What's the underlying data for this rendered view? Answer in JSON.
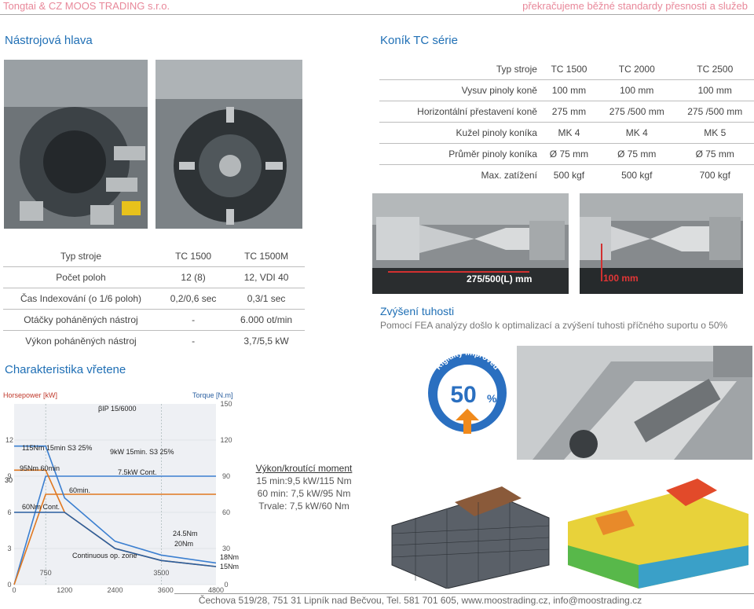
{
  "header": {
    "company": "Tongtai & CZ MOOS TRADING s.r.o.",
    "slogan": "překračujeme běžné standardy přesnosti a služeb"
  },
  "sections": {
    "tool_head": "Nástrojová hlava",
    "tailstock": "Koník TC série",
    "spindle": "Charakteristika vřetene",
    "rigidity_title": "Zvýšení tuhosti",
    "rigidity_text": "Pomocí FEA analýzy došlo k optimalizací a  zvýšení tuhosti příčného suportu o 50%"
  },
  "tailstock_table": {
    "header": [
      "Typ stroje",
      "TC 1500",
      "TC 2000",
      "TC 2500"
    ],
    "rows": [
      [
        "Vysuv pinoly koně",
        "100 mm",
        "100 mm",
        "100 mm"
      ],
      [
        "Horizontální přestavení koně",
        "275 mm",
        "275 /500 mm",
        "275 /500 mm"
      ],
      [
        "Kužel pinoly koníka",
        "MK 4",
        "MK 4",
        "MK 5"
      ],
      [
        "Průměr pinoly koníka",
        "Ø 75 mm",
        "Ø 75 mm",
        "Ø 75 mm"
      ],
      [
        "Max. zatížení",
        "500 kgf",
        "500 kgf",
        "700 kgf"
      ]
    ]
  },
  "turret_table": {
    "header": [
      "Typ stroje",
      "TC 1500",
      "TC 1500M"
    ],
    "rows": [
      [
        "Počet poloh",
        "12 (8)",
        "12, VDI 40"
      ],
      [
        "Čas Indexování (o 1/6 poloh)",
        "0,2/0,6 sec",
        "0,3/1 sec"
      ],
      [
        "Otáčky poháněných nástroj",
        "-",
        "6.000 ot/min"
      ],
      [
        "Výkon poháněných nástroj",
        "-",
        "3,7/5,5 kW"
      ]
    ]
  },
  "photo_labels": {
    "tail_left": "275/500(L) mm",
    "tail_right": "100 mm",
    "badge_arc": "Rigidity improved",
    "badge_value": "50",
    "badge_unit": "%"
  },
  "power_caption": {
    "title": "Výkon/kroutící moment",
    "line1": "15 min:9,5 kW/115 Nm",
    "line2": "60 min: 7,5 kW/95 Nm",
    "line3": "Trvale: 7,5 kW/60 Nm"
  },
  "chart_data": {
    "type": "line",
    "title": "",
    "y_left_label": "Horsepower [kW]",
    "y_right_label": "Torque [N.m]",
    "x_ticks": [
      0,
      1200,
      2400,
      3600,
      4800
    ],
    "x_extra_ticks": [
      750,
      3500
    ],
    "y_left_ticks": [
      0,
      3,
      6,
      9,
      12
    ],
    "y_right_ticks": [
      0,
      30,
      60,
      90,
      120,
      150
    ],
    "ylim_left": [
      0,
      15
    ],
    "ylim_right": [
      0,
      150
    ],
    "xlim": [
      0,
      4800
    ],
    "annotations": [
      "βIP 15/6000",
      "115Nm 15min S3 25%",
      "9kW 15min. S3 25%",
      "95Nm 60min",
      "7.5kW Cont.",
      "60min.",
      "60Nm Cont.",
      "24.5Nm",
      "20Nm",
      "18Nm",
      "15Nm",
      "30",
      "Continuous op. zone"
    ],
    "series": [
      {
        "name": "9kW 15min. S3 25%",
        "color": "#3b7fd0",
        "x": [
          0,
          750,
          4800
        ],
        "y": [
          0,
          9,
          9
        ]
      },
      {
        "name": "7.5kW Cont.",
        "color": "#e07820",
        "x": [
          0,
          750,
          4800
        ],
        "y": [
          0,
          7.5,
          7.5
        ]
      },
      {
        "name": "115Nm 15min S3 25%",
        "color": "#3b7fd0",
        "x": [
          0,
          750,
          1200,
          2400,
          3500,
          4800
        ],
        "y": [
          115,
          115,
          72,
          36,
          24.5,
          18
        ]
      },
      {
        "name": "95Nm 60min",
        "color": "#e07820",
        "x": [
          0,
          750,
          1200,
          2400,
          3500,
          4800
        ],
        "y": [
          95,
          95,
          60,
          30,
          20,
          15
        ]
      },
      {
        "name": "60Nm Cont.",
        "color": "#2a5fa0",
        "x": [
          0,
          1200,
          2400,
          3500,
          4800
        ],
        "y": [
          60,
          60,
          30,
          20,
          15
        ]
      }
    ]
  },
  "footer": "Čechova 519/28, 751 31 Lipník nad Bečvou, Tel. 581 701 605, www.moostrading.cz, info@moostrading.cz",
  "colors": {
    "accent": "#1f6fb5",
    "header": "#e8889a",
    "chart_orange": "#e07820",
    "chart_blue": "#3b7fd0"
  }
}
